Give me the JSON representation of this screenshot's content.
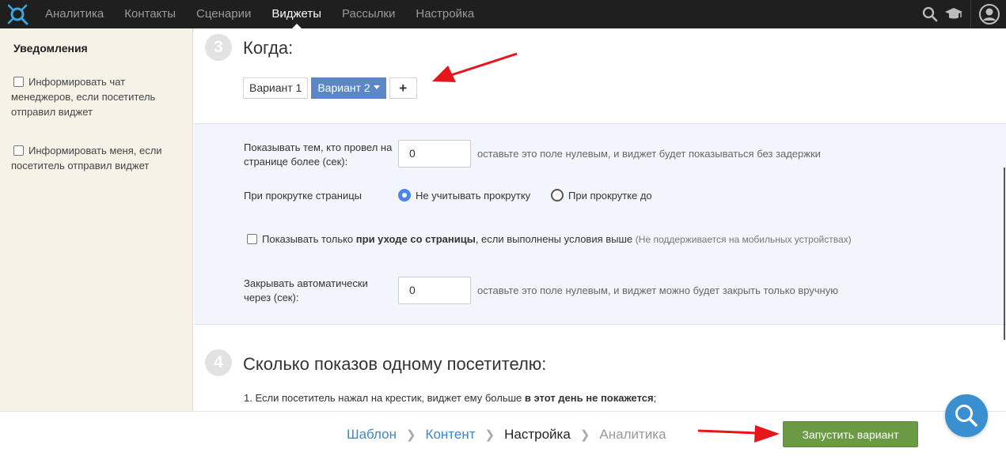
{
  "nav": {
    "logo": "logo-icon",
    "items": [
      "Аналитика",
      "Контакты",
      "Сценарии",
      "Виджеты",
      "Рассылки",
      "Настройка"
    ],
    "active": "Виджеты",
    "icons": [
      "search-icon",
      "graduation-cap-icon",
      "user-avatar-icon"
    ]
  },
  "sidebar": {
    "title": "Уведомления",
    "checkboxes": [
      {
        "label": "Информировать чат менеджеров, если посетитель отправил виджет",
        "checked": false
      },
      {
        "label": "Информировать меня, если посетитель отправил виджет",
        "checked": false
      }
    ]
  },
  "step3": {
    "number": "3",
    "title": "Когда:",
    "tabs": [
      "Вариант 1",
      "Вариант 2"
    ],
    "active_tab": "Вариант 2",
    "add_tab": "+"
  },
  "settings": {
    "delay_label": "Показывать тем, кто провел на странице более (сек):",
    "delay_value": "0",
    "delay_hint": "оставьте это поле нулевым, и виджет будет показываться без задержки",
    "scroll_label": "При прокрутке страницы",
    "scroll_options": [
      "Не учитывать прокрутку",
      "При прокрутке до"
    ],
    "scroll_selected": "Не учитывать прокрутку",
    "exit_prefix": "Показывать только",
    "exit_bold": "при уходе со страницы",
    "exit_suffix": ", если выполнены условия выше",
    "exit_note": "(Не поддерживается на мобильных устройствах)",
    "exit_checked": false,
    "close_label": "Закрывать автоматически через (сек):",
    "close_value": "0",
    "close_hint": "оставьте это поле нулевым, и виджет можно будет закрыть только вручную"
  },
  "step4": {
    "number": "4",
    "title": "Сколько показов одному посетителю:",
    "rule_prefix": "1. Если посетитель нажал на крестик, виджет ему больше",
    "rule_bold": "в этот день не покажется",
    "rule_suffix": ";"
  },
  "footer": {
    "crumbs": [
      "Шаблон",
      "Контент",
      "Настройка",
      "Аналитика"
    ],
    "current": "Настройка",
    "launch": "Запустить вариант"
  },
  "colors": {
    "accent_blue": "#5b87c6",
    "launch_green": "#6a9a43",
    "link_blue": "#3d87c4",
    "annotation_red": "#e8161b"
  }
}
